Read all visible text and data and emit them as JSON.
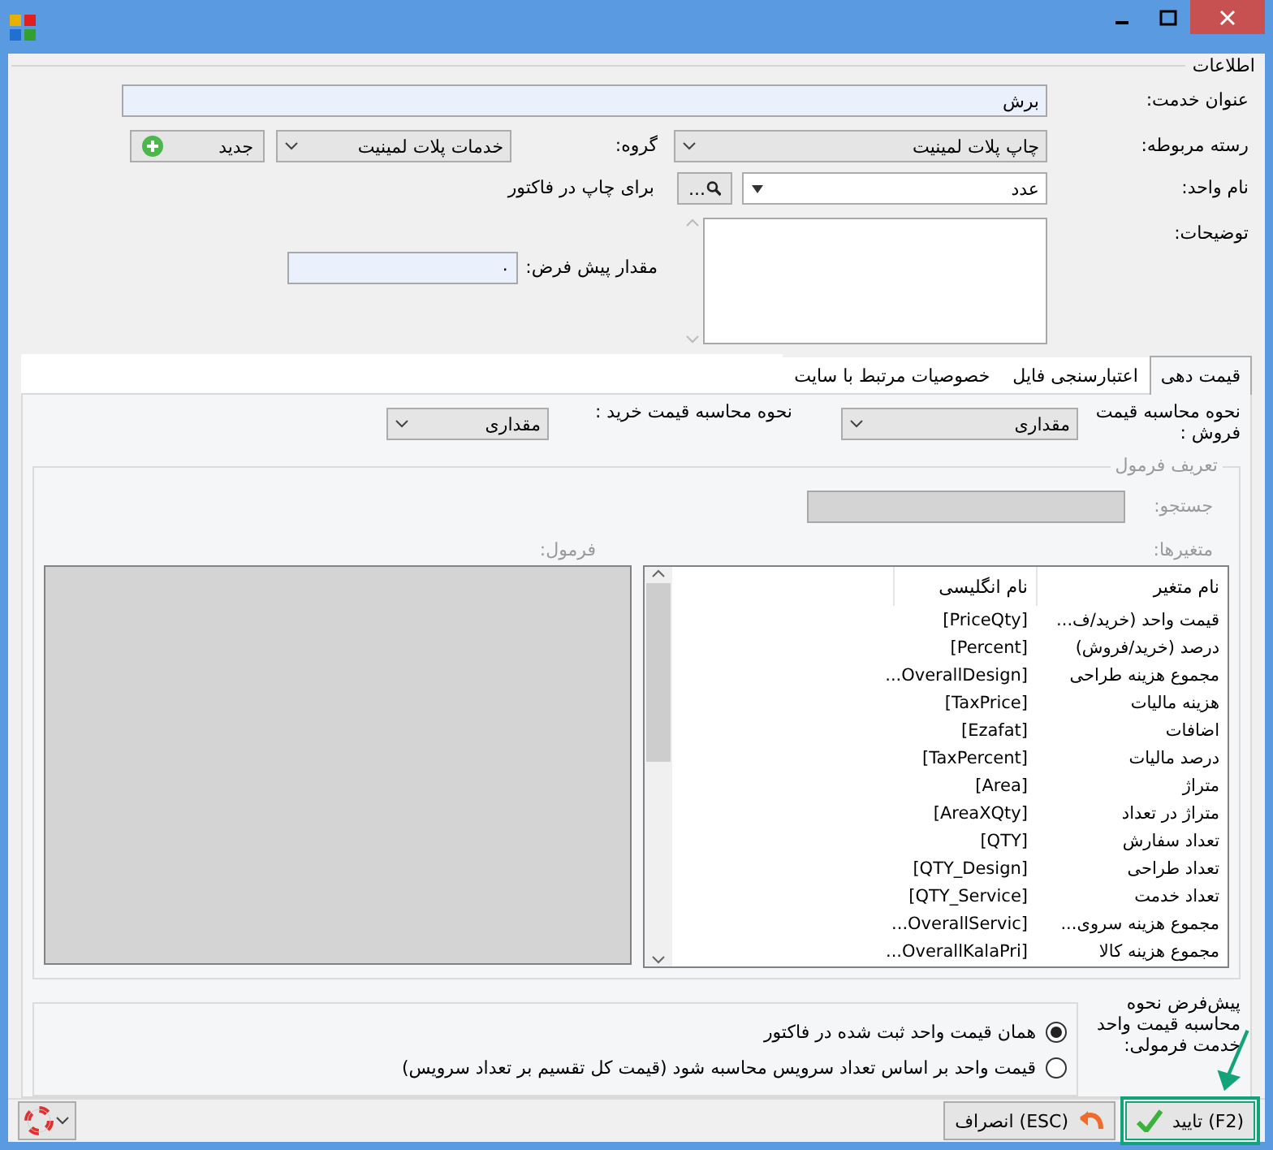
{
  "window": {
    "title_icon": true
  },
  "info_group": {
    "title": "اطلاعات"
  },
  "fields": {
    "service_title": {
      "label": "عنوان خدمت:",
      "value": "برش"
    },
    "category": {
      "label": "رسته مربوطه:",
      "value": "چاپ پلات لمینیت"
    },
    "group": {
      "label": "گروه:",
      "value": "خدمات پلات لمینیت"
    },
    "new_button": "جدید",
    "unit": {
      "label": "نام واحد:",
      "value": "عدد",
      "search_button": "...",
      "hint": "برای چاپ در فاکتور"
    },
    "description": {
      "label": "توضیحات:"
    },
    "default_amount": {
      "label": "مقدار پیش فرض:",
      "value": "۰"
    }
  },
  "tabs": [
    {
      "label": "قیمت دهی",
      "selected": true
    },
    {
      "label": "اعتبارسنجی فایل",
      "selected": false
    },
    {
      "label": "خصوصیات مرتبط با سایت",
      "selected": false
    }
  ],
  "pricing": {
    "sale_label": "نحوه محاسبه قیمت فروش :",
    "sale_value": "مقداری",
    "buy_label": "نحوه محاسبه قیمت خرید :",
    "buy_value": "مقداری"
  },
  "formula_group": {
    "title": "تعریف فرمول",
    "disabled": true,
    "search_label": "جستجو:",
    "variables_label": "متغیرها:",
    "formula_label": "فرمول:",
    "columns": [
      "نام متغیر",
      "نام انگلیسی"
    ],
    "rows": [
      [
        "قیمت واحد (خرید/ف...",
        "[PriceQty]"
      ],
      [
        "درصد (خرید/فروش)",
        "[Percent]"
      ],
      [
        "مجموع هزینه طراحی",
        "...OverallDesign]"
      ],
      [
        "هزینه مالیات",
        "[TaxPrice]"
      ],
      [
        "اضافات",
        "[Ezafat]"
      ],
      [
        "درصد مالیات",
        "[TaxPercent]"
      ],
      [
        "متراژ",
        "[Area]"
      ],
      [
        "متراژ در تعداد",
        "[AreaXQty]"
      ],
      [
        "تعداد سفارش",
        "[QTY]"
      ],
      [
        "تعداد طراحی",
        "[QTY_Design]"
      ],
      [
        "تعداد خدمت",
        "[QTY_Service]"
      ],
      [
        "مجموع هزینه سروی...",
        "...OverallServic]"
      ],
      [
        "مجموع هزینه کالا",
        "...OverallKalaPri]"
      ]
    ]
  },
  "default_method": {
    "label": "پیش‌فرض نحوه محاسبه قیمت واحد خدمت فرمولی:",
    "options": [
      {
        "label": "همان قیمت واحد ثبت شده در فاکتور",
        "selected": true
      },
      {
        "label": "قیمت واحد بر اساس تعداد سرویس محاسبه شود (قیمت کل تقسیم بر تعداد سرویس)",
        "selected": false
      }
    ]
  },
  "footer": {
    "ok_button": "(F2) تایید",
    "cancel_button": "(ESC) انصراف"
  }
}
